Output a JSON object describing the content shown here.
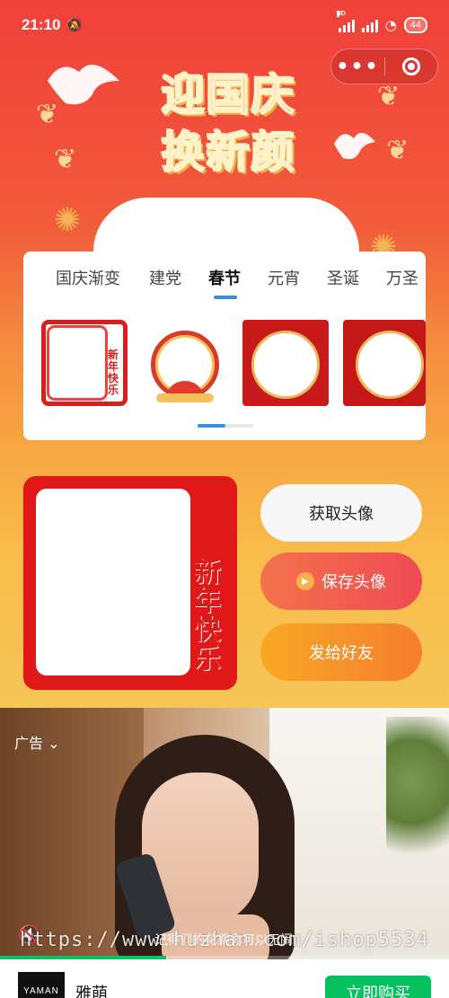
{
  "status_bar": {
    "time": "21:10",
    "signal_label": "HD",
    "battery": "44"
  },
  "banner": {
    "title_line1": "迎国庆",
    "title_line2": "换新颜"
  },
  "tabs": [
    {
      "label": "国庆渐变",
      "active": false
    },
    {
      "label": "建党",
      "active": false
    },
    {
      "label": "春节",
      "active": true
    },
    {
      "label": "元宵",
      "active": false
    },
    {
      "label": "圣诞",
      "active": false
    },
    {
      "label": "万圣",
      "active": false
    }
  ],
  "frames": {
    "thumb_text": "新年快乐",
    "carousel_page": 1,
    "carousel_pages": 2
  },
  "preview": {
    "text": "新年快乐"
  },
  "actions": {
    "get_avatar": "获取头像",
    "save_avatar": "保存头像",
    "send_friend": "发给好友"
  },
  "ad": {
    "label": "广告",
    "caption": "记得们的花期你可以无闹",
    "watermark": "https://www.huzhan.com/ishop5534",
    "progress": 0.37,
    "brand_logo": "YAMAN",
    "brand_name": "雅萌",
    "buy_label": "立即购买"
  },
  "colors": {
    "accent_blue": "#3a8de0",
    "ad_green": "#07c160",
    "frame_red": "#e01818"
  }
}
